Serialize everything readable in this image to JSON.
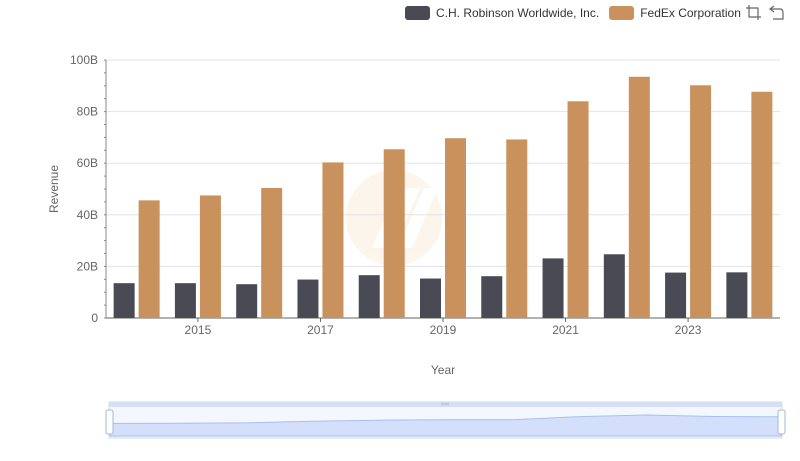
{
  "legend": [
    {
      "name": "C.H. Robinson Worldwide, Inc.",
      "color": "#4a4a55"
    },
    {
      "name": "FedEx Corporation",
      "color": "#c9915c"
    }
  ],
  "toolbox": {
    "zoom_icon": "zoom-icon",
    "restore_icon": "restore-icon"
  },
  "chart_data": {
    "type": "bar",
    "xlabel": "Year",
    "ylabel": "Revenue",
    "ylim": [
      0,
      100
    ],
    "y_ticks": [
      "0",
      "20B",
      "40B",
      "60B",
      "80B",
      "100B"
    ],
    "x_tick_labels": [
      "2015",
      "2017",
      "2019",
      "2021",
      "2023"
    ],
    "categories": [
      "2014",
      "2015",
      "2016",
      "2017",
      "2018",
      "2019",
      "2020",
      "2021",
      "2022",
      "2023",
      "2024"
    ],
    "series": [
      {
        "name": "C.H. Robinson Worldwide, Inc.",
        "color": "#4a4a55",
        "values": [
          13.5,
          13.5,
          13.1,
          14.9,
          16.6,
          15.3,
          16.2,
          23.1,
          24.7,
          17.6,
          17.7
        ]
      },
      {
        "name": "FedEx Corporation",
        "color": "#c9915c",
        "values": [
          45.6,
          47.5,
          50.4,
          60.3,
          65.4,
          69.7,
          69.2,
          84.0,
          93.5,
          90.2,
          87.7
        ]
      }
    ],
    "grid": true,
    "legend_position": "top-right"
  }
}
